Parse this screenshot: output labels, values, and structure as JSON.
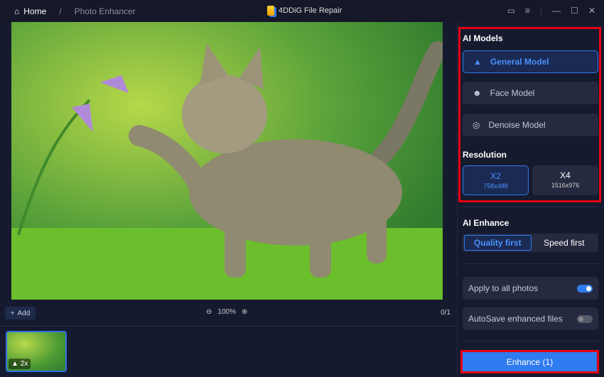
{
  "titlebar": {
    "home": "Home",
    "separator": "/",
    "page": "Photo Enhancer",
    "app_title": "4DDiG File Repair"
  },
  "toolbar": {
    "add": "Add",
    "zoom": "100%",
    "count": "0/1"
  },
  "thumbnail": {
    "badge": "2x"
  },
  "panel": {
    "ai_models_title": "AI Models",
    "models": [
      {
        "label": "General Model",
        "selected": true
      },
      {
        "label": "Face Model"
      },
      {
        "label": "Denoise Model"
      }
    ],
    "resolution_title": "Resolution",
    "resolutions": [
      {
        "label": "X2",
        "size": "758x488",
        "selected": true
      },
      {
        "label": "X4",
        "size": "1516x976"
      }
    ],
    "ai_enhance_title": "AI Enhance",
    "enhance_modes": [
      {
        "label": "Quality first",
        "selected": true
      },
      {
        "label": "Speed first"
      }
    ],
    "apply_all": {
      "label": "Apply to all photos",
      "on": true
    },
    "autosave": {
      "label": "AutoSave enhanced files",
      "on": false
    },
    "enhance_button": "Enhance (1)"
  },
  "colors": {
    "accent": "#2f7bf0",
    "highlight": "#e60012"
  }
}
